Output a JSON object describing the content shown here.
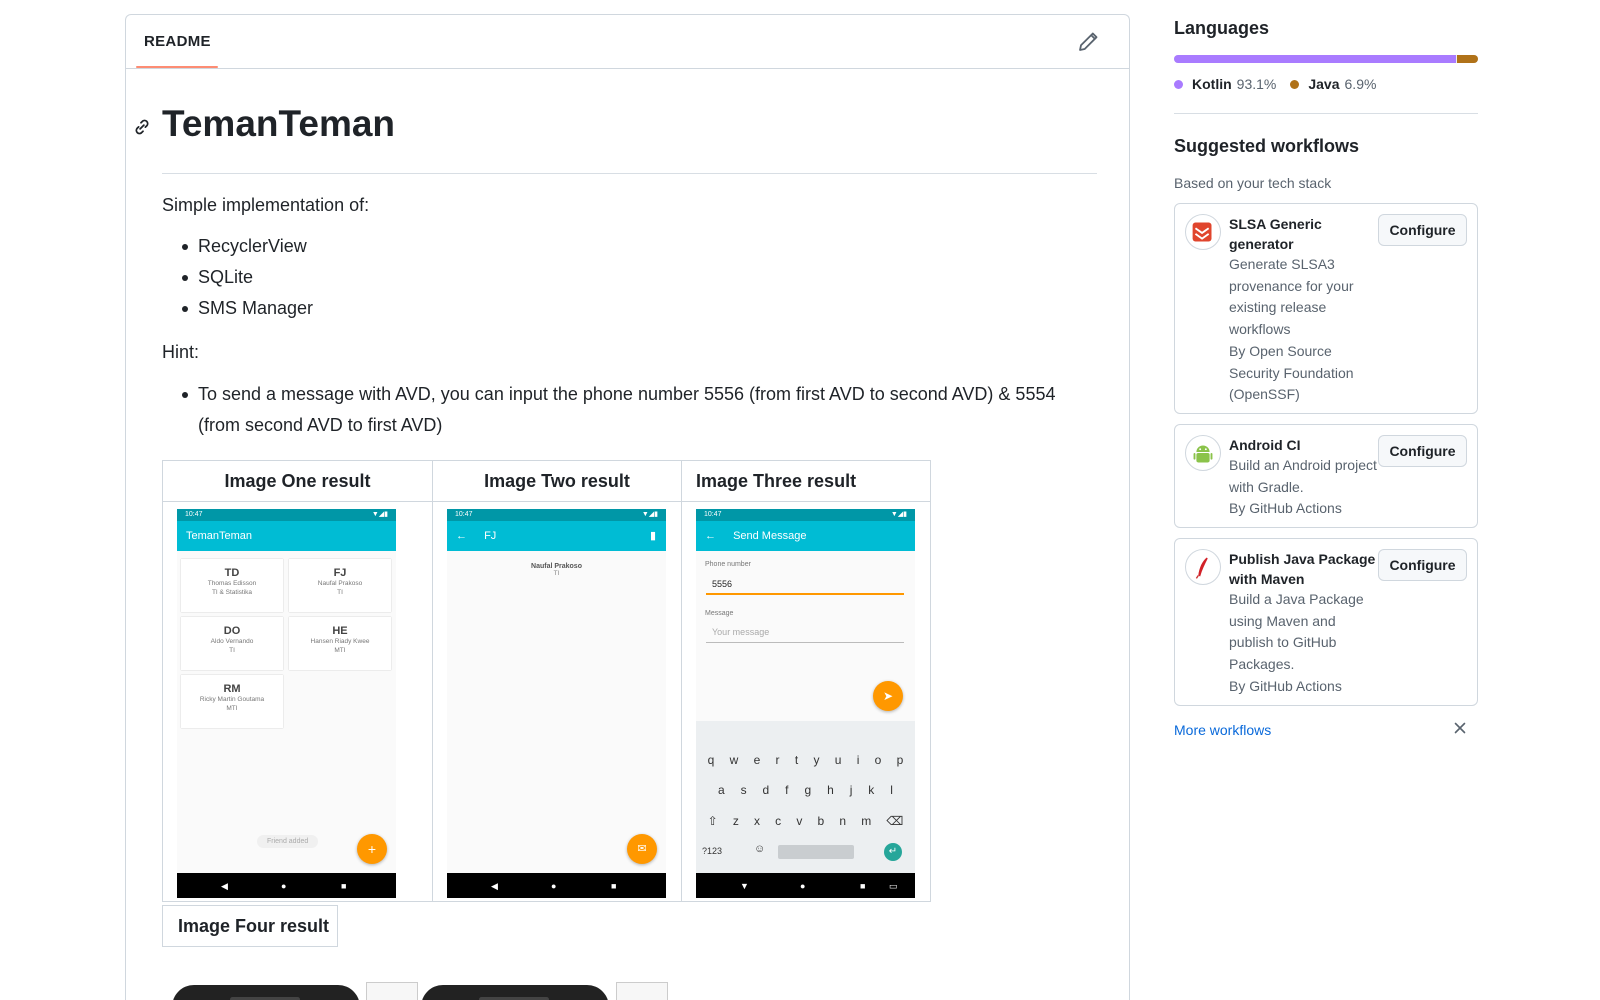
{
  "readme": {
    "tab_label": "README",
    "title": "TemanTeman",
    "intro": "Simple implementation of:",
    "features": [
      "RecyclerView",
      "SQLite",
      "SMS Manager"
    ],
    "hint_label": "Hint:",
    "hints": [
      "To send a message with AVD, you can input the phone number 5556 (from first AVD to second AVD) & 5554 (from second AVD to first AVD)"
    ],
    "image_table": {
      "headers": [
        "Image One result",
        "Image Two result",
        "Image Three result"
      ]
    },
    "image_four_header": "Image Four result"
  },
  "screens": {
    "time": "10:47",
    "one": {
      "appbar_title": "TemanTeman",
      "cards": [
        {
          "initials": "TD",
          "name": "Thomas Edisson",
          "group": "TI & Statistika"
        },
        {
          "initials": "FJ",
          "name": "Naufal Prakoso",
          "group": "TI"
        },
        {
          "initials": "DO",
          "name": "Aldo Vernando",
          "group": "TI"
        },
        {
          "initials": "HE",
          "name": "Hansen Riady Kwee",
          "group": "MTI"
        },
        {
          "initials": "RM",
          "name": "Ricky Martin Goutama",
          "group": "MTI"
        }
      ],
      "toast": "Friend added"
    },
    "two": {
      "appbar_title": "FJ",
      "name": "Naufal Prakoso",
      "group": "TI"
    },
    "three": {
      "appbar_title": "Send Message",
      "phone_label": "Phone number",
      "phone_value": "5556",
      "message_label": "Message",
      "message_placeholder": "Your message",
      "keyboard_rows": [
        [
          "q",
          "w",
          "e",
          "r",
          "t",
          "y",
          "u",
          "i",
          "o",
          "p"
        ],
        [
          "a",
          "s",
          "d",
          "f",
          "g",
          "h",
          "j",
          "k",
          "l"
        ],
        [
          "z",
          "x",
          "c",
          "v",
          "b",
          "n",
          "m"
        ]
      ],
      "symbols_key": "?123"
    }
  },
  "sidebar": {
    "languages_title": "Languages",
    "languages": [
      {
        "name": "Kotlin",
        "percent": "93.1%",
        "value": 93.1,
        "color": "#A97BFF"
      },
      {
        "name": "Java",
        "percent": "6.9%",
        "value": 6.9,
        "color": "#b07219"
      }
    ],
    "workflows_title": "Suggested workflows",
    "workflows_subtitle": "Based on your tech stack",
    "workflows": [
      {
        "name": "SLSA Generic generator",
        "description": "Generate SLSA3 provenance for your existing release workflows",
        "author": "By Open Source Security Foundation (OpenSSF)",
        "icon": "slsa-icon",
        "button": "Configure"
      },
      {
        "name": "Android CI",
        "description": "Build an Android project with Gradle.",
        "author": "By GitHub Actions",
        "icon": "android-icon",
        "button": "Configure"
      },
      {
        "name": "Publish Java Package with Maven",
        "description": "Build a Java Package using Maven and publish to GitHub Packages.",
        "author": "By GitHub Actions",
        "icon": "maven-feather-icon",
        "button": "Configure"
      }
    ],
    "more_workflows": "More workflows"
  }
}
